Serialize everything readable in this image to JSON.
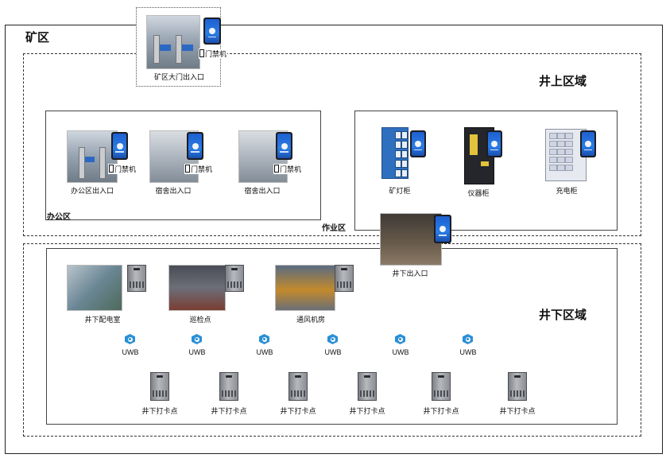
{
  "mine_area": {
    "title": "矿区"
  },
  "main_gate": {
    "label": "矿区大门出入口",
    "device_label": "门禁机"
  },
  "above_ground": {
    "title": "井上区域"
  },
  "office_zone": {
    "label": "办公区",
    "entrances": [
      {
        "label": "办公区出入口",
        "device_label": "门禁机"
      },
      {
        "label": "宿舍出入口",
        "device_label": "门禁机"
      },
      {
        "label": "宿舍出入口",
        "device_label": "门禁机"
      }
    ]
  },
  "work_zone": {
    "label": "作业区",
    "cabinets": [
      {
        "label": "矿灯柜"
      },
      {
        "label": "仪器柜"
      },
      {
        "label": "充电柜"
      }
    ]
  },
  "underground_entrance": {
    "label": "井下出入口"
  },
  "underground": {
    "title": "井下区域",
    "rooms": [
      {
        "label": "井下配电室"
      },
      {
        "label": "巡检点"
      },
      {
        "label": "通风机房"
      }
    ],
    "uwb_labels": [
      "UWB",
      "UWB",
      "UWB",
      "UWB",
      "UWB",
      "UWB"
    ],
    "checkpoints": [
      "井下打卡点",
      "井下打卡点",
      "井下打卡点",
      "井下打卡点",
      "井下打卡点",
      "井下打卡点"
    ]
  },
  "colors": {
    "uwb": "#2a8fd6",
    "terminal_screen": "#2a7de8",
    "lamp_cabinet": "#2f6fbf"
  }
}
